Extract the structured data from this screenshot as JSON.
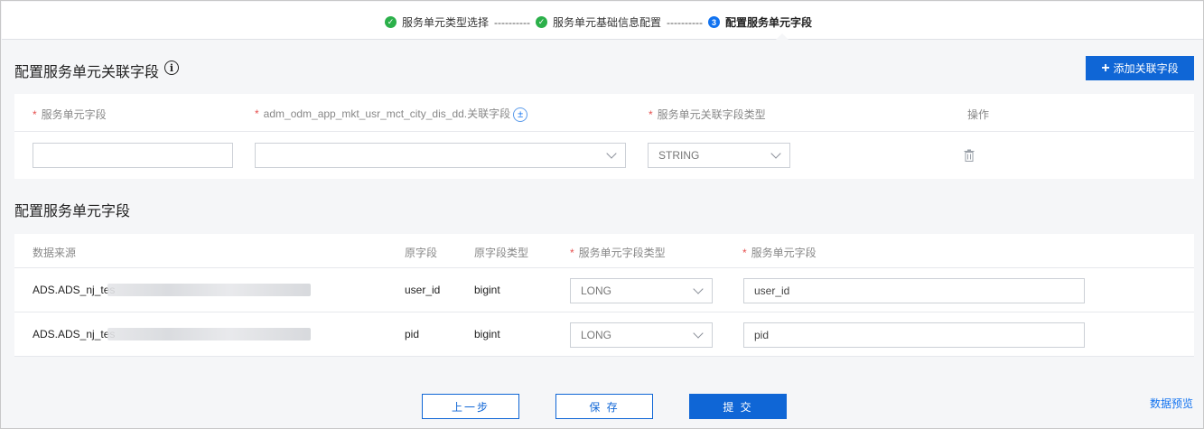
{
  "steps": {
    "step1": "服务单元类型选择",
    "step2": "服务单元基础信息配置",
    "step3_number": "3",
    "step3": "配置服务单元字段",
    "separator": "----------"
  },
  "section1": {
    "title": "配置服务单元关联字段",
    "add_button": "添加关联字段",
    "headers": {
      "field": "服务单元字段",
      "related_field": "adm_odm_app_mkt_usr_mct_city_dis_dd.关联字段",
      "type": "服务单元关联字段类型",
      "action": "操作"
    },
    "row": {
      "field_value": "",
      "related_value": "",
      "type_value": "STRING"
    }
  },
  "section2": {
    "title": "配置服务单元字段",
    "headers": {
      "source": "数据来源",
      "orig_field": "原字段",
      "orig_type": "原字段类型",
      "unit_type": "服务单元字段类型",
      "unit_field": "服务单元字段"
    },
    "rows": [
      {
        "source": "ADS.ADS_nj_tes",
        "orig_field": "user_id",
        "orig_type": "bigint",
        "unit_type": "LONG",
        "unit_field": "user_id"
      },
      {
        "source": "ADS.ADS_nj_tes",
        "orig_field": "pid",
        "orig_type": "bigint",
        "unit_type": "LONG",
        "unit_field": "pid"
      }
    ]
  },
  "footer": {
    "prev": "上一步",
    "save": "保 存",
    "submit": "提 交",
    "preview": "数据预览"
  },
  "colors": {
    "primary": "#0f66d6",
    "success": "#2bb04a",
    "required": "#e6504f"
  }
}
